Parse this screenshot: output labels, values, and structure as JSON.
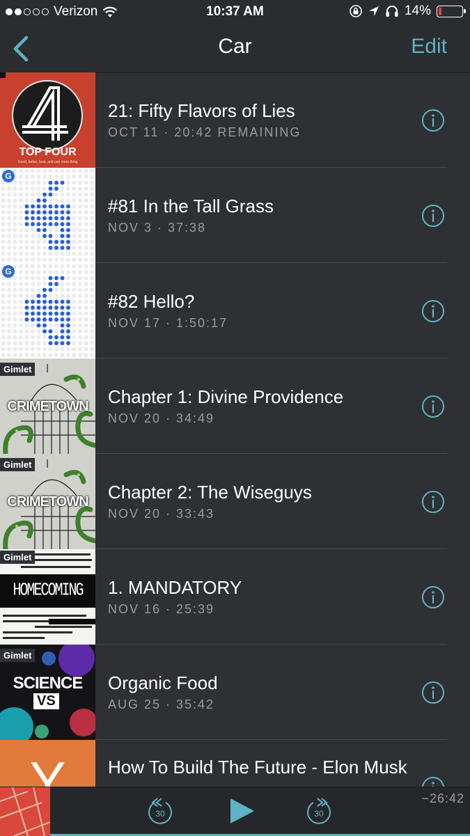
{
  "status_bar": {
    "carrier": "Verizon",
    "time": "10:37 AM",
    "battery": "14%",
    "battery_level": 0.14
  },
  "nav": {
    "back_icon": "chevron-left-icon",
    "title": "Car",
    "edit_label": "Edit"
  },
  "episodes": [
    {
      "title": "21: Fifty Flavors of Lies",
      "meta": "OCT 11 · 20:42 REMAINING",
      "art": "top-four"
    },
    {
      "title": "#81 In the Tall Grass",
      "meta": "NOV 3 · 37:38",
      "art": "dot-arrow"
    },
    {
      "title": "#82 Hello?",
      "meta": "NOV 17 · 1:50:17",
      "art": "dot-arrow"
    },
    {
      "title": "Chapter 1: Divine Providence",
      "meta": "NOV 20 · 34:49",
      "art": "crimetown"
    },
    {
      "title": "Chapter 2: The Wiseguys",
      "meta": "NOV 20 · 33:43",
      "art": "crimetown"
    },
    {
      "title": "1. MANDATORY",
      "meta": "NOV 16 · 25:39",
      "art": "homecoming"
    },
    {
      "title": "Organic Food",
      "meta": "AUG 25 · 35:42",
      "art": "science-vs"
    },
    {
      "title": "How To Build The Future - Elon Musk",
      "meta": "",
      "art": "y-combinator"
    }
  ],
  "artwork_text": {
    "top_four": {
      "title": "TOP FOUR",
      "tagline": "Good, better, best, and one more thing"
    },
    "gimlet": "Gimlet",
    "crimetown": "CRIMETOWN",
    "homecoming": "HOMECOMING",
    "science_vs": [
      "SCIENCE",
      "VS"
    ],
    "ycomb": "Y",
    "g_badge": "G"
  },
  "player": {
    "skip_back_label": "30",
    "skip_forward_label": "30",
    "remaining": "−26:42"
  },
  "colors": {
    "accent": "#5eb3c6",
    "background": "#2f3033",
    "meta_text": "#9a9ba0"
  }
}
